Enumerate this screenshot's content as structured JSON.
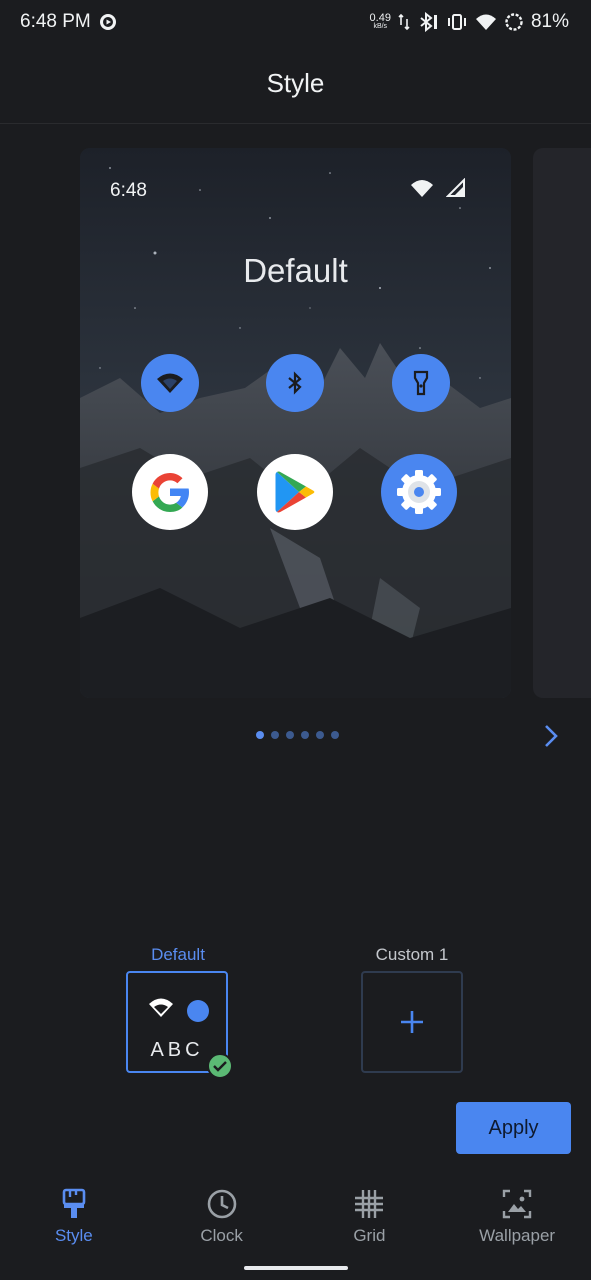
{
  "status_bar": {
    "time": "6:48 PM",
    "net_speed_value": "0.49",
    "net_speed_unit": "kB/s",
    "battery": "81%",
    "icons": [
      "podcast-icon",
      "data-arrows-icon",
      "bluetooth-icon",
      "vibrate-icon",
      "wifi-icon",
      "battery-saver-icon"
    ]
  },
  "header": {
    "title": "Style"
  },
  "preview": {
    "time": "6:48",
    "title": "Default",
    "quick_settings": [
      "wifi-icon",
      "bluetooth-icon",
      "flashlight-icon"
    ],
    "apps": [
      "google-icon",
      "play-store-icon",
      "settings-icon"
    ]
  },
  "pager": {
    "count": 6,
    "active_index": 0
  },
  "options": {
    "default_label": "Default",
    "default_sample": "ABC",
    "custom_label": "Custom 1"
  },
  "actions": {
    "apply_label": "Apply"
  },
  "bottom_nav": {
    "items": [
      {
        "label": "Style",
        "icon": "brush-icon",
        "active": true
      },
      {
        "label": "Clock",
        "icon": "clock-icon",
        "active": false
      },
      {
        "label": "Grid",
        "icon": "grid-icon",
        "active": false
      },
      {
        "label": "Wallpaper",
        "icon": "wallpaper-icon",
        "active": false
      }
    ]
  },
  "colors": {
    "background": "#1b1c1f",
    "accent": "#4a86f0",
    "success": "#5bb974"
  }
}
